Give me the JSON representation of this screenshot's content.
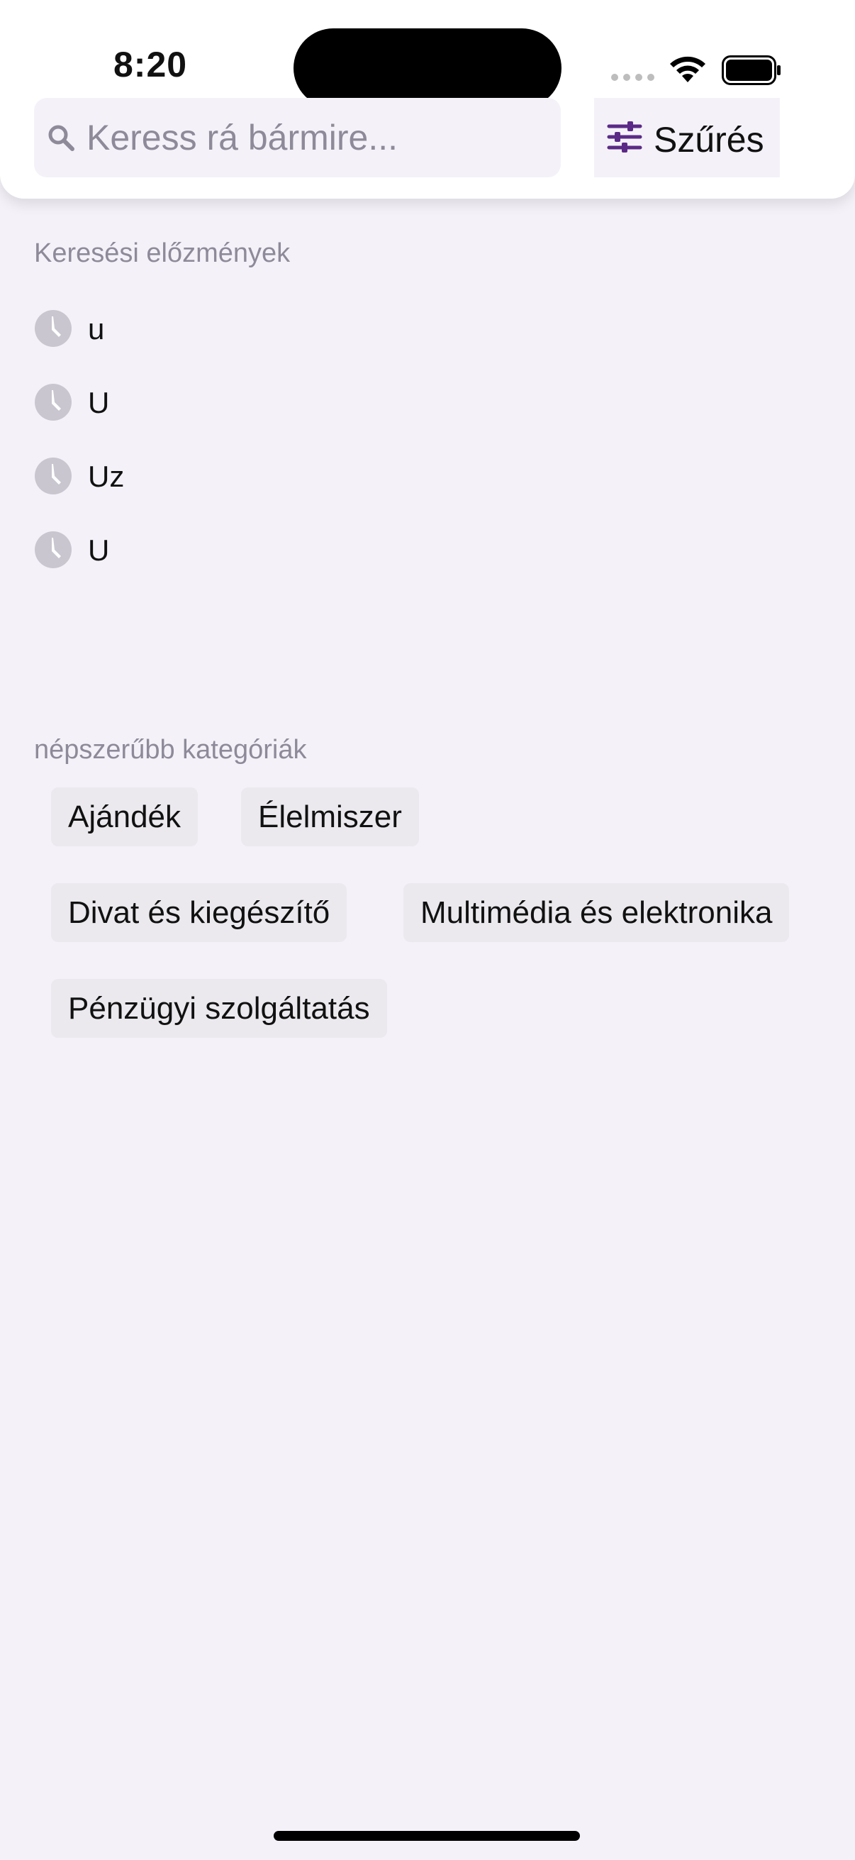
{
  "status_bar": {
    "time": "8:20"
  },
  "search": {
    "placeholder": "Keress rá bármire..."
  },
  "filter": {
    "label": "Szűrés",
    "accent_color": "#5b2a86"
  },
  "history": {
    "title": "Keresési előzmények",
    "items": [
      {
        "label": "u",
        "icon": "clock-icon"
      },
      {
        "label": "U",
        "icon": "clock-icon"
      },
      {
        "label": "Uz",
        "icon": "clock-icon"
      },
      {
        "label": "U",
        "icon": "clock-icon"
      }
    ]
  },
  "categories": {
    "title": "népszerűbb kategóriák",
    "items": [
      {
        "label": "Ajándék"
      },
      {
        "label": "Élelmiszer"
      },
      {
        "label": "Divat és kiegészítő"
      },
      {
        "label": "Multimédia és elektronika"
      },
      {
        "label": "Pénzügyi szolgáltatás"
      }
    ]
  }
}
